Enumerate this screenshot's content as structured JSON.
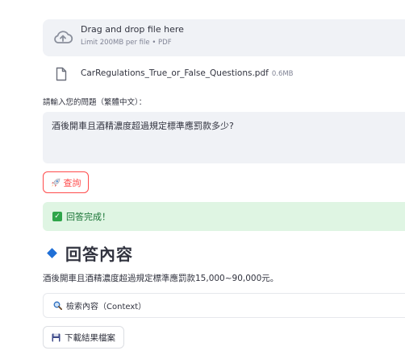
{
  "uploader": {
    "title": "Drag and drop file here",
    "limit": "Limit 200MB per file • PDF",
    "icon": "cloud-upload-icon"
  },
  "file": {
    "name": "CarRegulations_True_or_False_Questions.pdf",
    "size": "0.6MB",
    "icon": "file-icon"
  },
  "question": {
    "label": "請輸入您的問題（繁體中文）：",
    "value": "酒後開車且酒精濃度超過規定標準應罰款多少?"
  },
  "query_button": {
    "label": "查詢",
    "icon": "rocket-icon",
    "color": "#ff4b4b"
  },
  "status": {
    "text": "回答完成！",
    "icon": "check-icon",
    "color": "#177233"
  },
  "answer_section": {
    "title": "回答內容",
    "icon": "diamond-icon",
    "text": "酒後開車且酒精濃度超過規定標準應罰款15,000~90,000元。"
  },
  "context_expander": {
    "label": "檢索內容（Context）",
    "icon": "magnifier-icon"
  },
  "download_button": {
    "label": "下載結果檔案",
    "icon": "floppy-disk-icon"
  }
}
